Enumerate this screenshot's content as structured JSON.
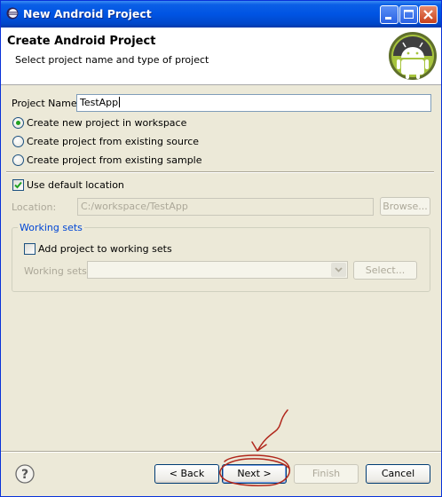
{
  "window": {
    "title": "New Android Project"
  },
  "header": {
    "title": "Create Android Project",
    "subtitle": "Select project name and type of project"
  },
  "project": {
    "name_label": "Project Name:",
    "name_value": "TestApp",
    "options": [
      {
        "label": "Create new project in workspace",
        "selected": true
      },
      {
        "label": "Create project from existing source",
        "selected": false
      },
      {
        "label": "Create project from existing sample",
        "selected": false
      }
    ]
  },
  "location": {
    "use_default_label": "Use default location",
    "use_default_checked": true,
    "label": "Location:",
    "value": "C:/workspace/TestApp",
    "browse_label": "Browse..."
  },
  "working_sets": {
    "group_label": "Working sets",
    "add_label": "Add project to working sets",
    "add_checked": false,
    "field_label": "Working sets:",
    "select_label": "Select..."
  },
  "buttons": {
    "back": "< Back",
    "next": "Next >",
    "finish": "Finish",
    "cancel": "Cancel"
  },
  "colors": {
    "titlebar": "#0054e3",
    "dialog_bg": "#ece9d8",
    "accent_link": "#0046d5",
    "radio_dot": "#21a121",
    "annotation": "#b1271c"
  }
}
